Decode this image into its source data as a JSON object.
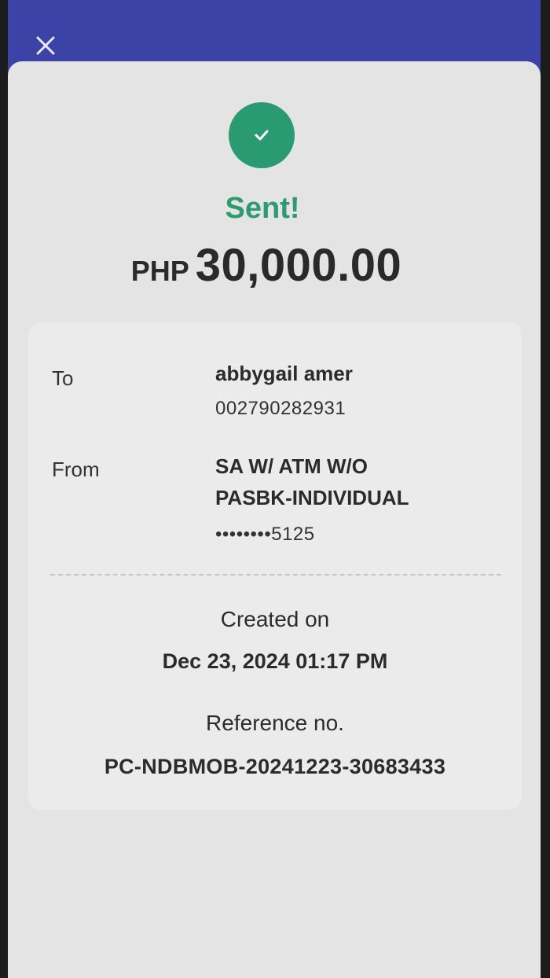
{
  "header": {
    "close_icon": "close-icon"
  },
  "status": {
    "icon": "check-icon",
    "text": "Sent!",
    "color": "#2d9a72"
  },
  "amount": {
    "currency": "PHP",
    "value": "30,000.00"
  },
  "details": {
    "to": {
      "label": "To",
      "name": "abbygail amer",
      "account": "002790282931"
    },
    "from": {
      "label": "From",
      "line1": "SA W/ ATM W/O",
      "line2": "PASBK-INDIVIDUAL",
      "account": "••••••••5125"
    },
    "created": {
      "label": "Created on",
      "value": "Dec 23, 2024 01:17 PM"
    },
    "reference": {
      "label": "Reference no.",
      "value": "PC-NDBMOB-20241223-30683433"
    }
  },
  "colors": {
    "header_bg": "#3c43a6",
    "success": "#2a9a72"
  }
}
